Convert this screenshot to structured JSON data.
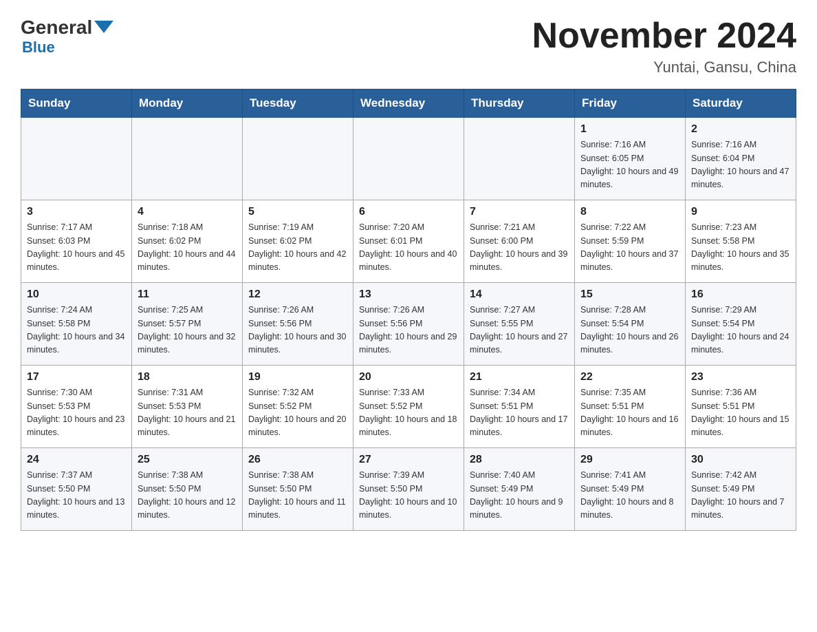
{
  "logo": {
    "general": "General",
    "blue": "Blue"
  },
  "title": "November 2024",
  "location": "Yuntai, Gansu, China",
  "weekdays": [
    "Sunday",
    "Monday",
    "Tuesday",
    "Wednesday",
    "Thursday",
    "Friday",
    "Saturday"
  ],
  "weeks": [
    [
      {
        "day": "",
        "sunrise": "",
        "sunset": "",
        "daylight": ""
      },
      {
        "day": "",
        "sunrise": "",
        "sunset": "",
        "daylight": ""
      },
      {
        "day": "",
        "sunrise": "",
        "sunset": "",
        "daylight": ""
      },
      {
        "day": "",
        "sunrise": "",
        "sunset": "",
        "daylight": ""
      },
      {
        "day": "",
        "sunrise": "",
        "sunset": "",
        "daylight": ""
      },
      {
        "day": "1",
        "sunrise": "Sunrise: 7:16 AM",
        "sunset": "Sunset: 6:05 PM",
        "daylight": "Daylight: 10 hours and 49 minutes."
      },
      {
        "day": "2",
        "sunrise": "Sunrise: 7:16 AM",
        "sunset": "Sunset: 6:04 PM",
        "daylight": "Daylight: 10 hours and 47 minutes."
      }
    ],
    [
      {
        "day": "3",
        "sunrise": "Sunrise: 7:17 AM",
        "sunset": "Sunset: 6:03 PM",
        "daylight": "Daylight: 10 hours and 45 minutes."
      },
      {
        "day": "4",
        "sunrise": "Sunrise: 7:18 AM",
        "sunset": "Sunset: 6:02 PM",
        "daylight": "Daylight: 10 hours and 44 minutes."
      },
      {
        "day": "5",
        "sunrise": "Sunrise: 7:19 AM",
        "sunset": "Sunset: 6:02 PM",
        "daylight": "Daylight: 10 hours and 42 minutes."
      },
      {
        "day": "6",
        "sunrise": "Sunrise: 7:20 AM",
        "sunset": "Sunset: 6:01 PM",
        "daylight": "Daylight: 10 hours and 40 minutes."
      },
      {
        "day": "7",
        "sunrise": "Sunrise: 7:21 AM",
        "sunset": "Sunset: 6:00 PM",
        "daylight": "Daylight: 10 hours and 39 minutes."
      },
      {
        "day": "8",
        "sunrise": "Sunrise: 7:22 AM",
        "sunset": "Sunset: 5:59 PM",
        "daylight": "Daylight: 10 hours and 37 minutes."
      },
      {
        "day": "9",
        "sunrise": "Sunrise: 7:23 AM",
        "sunset": "Sunset: 5:58 PM",
        "daylight": "Daylight: 10 hours and 35 minutes."
      }
    ],
    [
      {
        "day": "10",
        "sunrise": "Sunrise: 7:24 AM",
        "sunset": "Sunset: 5:58 PM",
        "daylight": "Daylight: 10 hours and 34 minutes."
      },
      {
        "day": "11",
        "sunrise": "Sunrise: 7:25 AM",
        "sunset": "Sunset: 5:57 PM",
        "daylight": "Daylight: 10 hours and 32 minutes."
      },
      {
        "day": "12",
        "sunrise": "Sunrise: 7:26 AM",
        "sunset": "Sunset: 5:56 PM",
        "daylight": "Daylight: 10 hours and 30 minutes."
      },
      {
        "day": "13",
        "sunrise": "Sunrise: 7:26 AM",
        "sunset": "Sunset: 5:56 PM",
        "daylight": "Daylight: 10 hours and 29 minutes."
      },
      {
        "day": "14",
        "sunrise": "Sunrise: 7:27 AM",
        "sunset": "Sunset: 5:55 PM",
        "daylight": "Daylight: 10 hours and 27 minutes."
      },
      {
        "day": "15",
        "sunrise": "Sunrise: 7:28 AM",
        "sunset": "Sunset: 5:54 PM",
        "daylight": "Daylight: 10 hours and 26 minutes."
      },
      {
        "day": "16",
        "sunrise": "Sunrise: 7:29 AM",
        "sunset": "Sunset: 5:54 PM",
        "daylight": "Daylight: 10 hours and 24 minutes."
      }
    ],
    [
      {
        "day": "17",
        "sunrise": "Sunrise: 7:30 AM",
        "sunset": "Sunset: 5:53 PM",
        "daylight": "Daylight: 10 hours and 23 minutes."
      },
      {
        "day": "18",
        "sunrise": "Sunrise: 7:31 AM",
        "sunset": "Sunset: 5:53 PM",
        "daylight": "Daylight: 10 hours and 21 minutes."
      },
      {
        "day": "19",
        "sunrise": "Sunrise: 7:32 AM",
        "sunset": "Sunset: 5:52 PM",
        "daylight": "Daylight: 10 hours and 20 minutes."
      },
      {
        "day": "20",
        "sunrise": "Sunrise: 7:33 AM",
        "sunset": "Sunset: 5:52 PM",
        "daylight": "Daylight: 10 hours and 18 minutes."
      },
      {
        "day": "21",
        "sunrise": "Sunrise: 7:34 AM",
        "sunset": "Sunset: 5:51 PM",
        "daylight": "Daylight: 10 hours and 17 minutes."
      },
      {
        "day": "22",
        "sunrise": "Sunrise: 7:35 AM",
        "sunset": "Sunset: 5:51 PM",
        "daylight": "Daylight: 10 hours and 16 minutes."
      },
      {
        "day": "23",
        "sunrise": "Sunrise: 7:36 AM",
        "sunset": "Sunset: 5:51 PM",
        "daylight": "Daylight: 10 hours and 15 minutes."
      }
    ],
    [
      {
        "day": "24",
        "sunrise": "Sunrise: 7:37 AM",
        "sunset": "Sunset: 5:50 PM",
        "daylight": "Daylight: 10 hours and 13 minutes."
      },
      {
        "day": "25",
        "sunrise": "Sunrise: 7:38 AM",
        "sunset": "Sunset: 5:50 PM",
        "daylight": "Daylight: 10 hours and 12 minutes."
      },
      {
        "day": "26",
        "sunrise": "Sunrise: 7:38 AM",
        "sunset": "Sunset: 5:50 PM",
        "daylight": "Daylight: 10 hours and 11 minutes."
      },
      {
        "day": "27",
        "sunrise": "Sunrise: 7:39 AM",
        "sunset": "Sunset: 5:50 PM",
        "daylight": "Daylight: 10 hours and 10 minutes."
      },
      {
        "day": "28",
        "sunrise": "Sunrise: 7:40 AM",
        "sunset": "Sunset: 5:49 PM",
        "daylight": "Daylight: 10 hours and 9 minutes."
      },
      {
        "day": "29",
        "sunrise": "Sunrise: 7:41 AM",
        "sunset": "Sunset: 5:49 PM",
        "daylight": "Daylight: 10 hours and 8 minutes."
      },
      {
        "day": "30",
        "sunrise": "Sunrise: 7:42 AM",
        "sunset": "Sunset: 5:49 PM",
        "daylight": "Daylight: 10 hours and 7 minutes."
      }
    ]
  ]
}
